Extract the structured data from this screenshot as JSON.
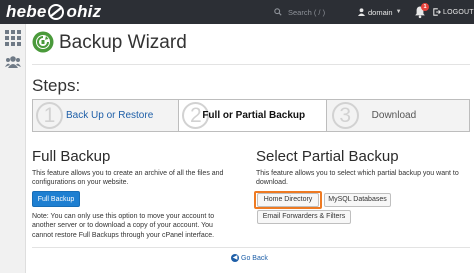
{
  "header": {
    "logo_text_left": "hebe",
    "logo_text_right": "ohiz",
    "search_placeholder": "Search ( / )",
    "username": "domain",
    "notification_count": "1",
    "logout_label": "LOGOUT"
  },
  "sidebar": {
    "items": [
      {
        "icon": "grid-icon"
      },
      {
        "icon": "users-icon"
      }
    ]
  },
  "page": {
    "title": "Backup Wizard",
    "steps_label": "Steps:"
  },
  "steps": [
    {
      "number": "1",
      "label": "Back Up or Restore",
      "state": "link"
    },
    {
      "number": "2",
      "label": "Full or Partial Backup",
      "state": "active"
    },
    {
      "number": "3",
      "label": "Download",
      "state": "inactive"
    }
  ],
  "full_backup": {
    "title": "Full Backup",
    "description_line1": "This feature allows you to create an archive of all the files and",
    "description_line2": "configurations on your website.",
    "button_label": "Full Backup",
    "note_line1": "Note: You can only use this option to move your account to",
    "note_line2": "another server or to download a copy of your account. You",
    "note_line3": "cannot restore Full Backups through your cPanel interface."
  },
  "partial_backup": {
    "title": "Select Partial Backup",
    "description_line1": "This feature allows you to select which partial backup you want to",
    "description_line2": "download.",
    "buttons": {
      "home_directory": "Home Directory",
      "mysql_databases": "MySQL Databases",
      "email_forwarders": "Email Forwarders & Filters"
    }
  },
  "footer": {
    "go_back_label": "Go Back"
  },
  "colors": {
    "topbar": "#2c2f35",
    "primary": "#1e7fd1",
    "highlight": "#ee7a22",
    "link": "#1e5fa8",
    "wizard_icon": "#4a9a3b"
  }
}
